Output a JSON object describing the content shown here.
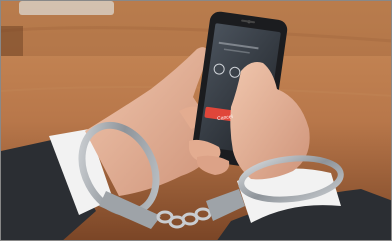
{
  "photo": {
    "subject": "",
    "phone_screen": {
      "call_button_label": "Cancel"
    },
    "colors": {
      "table": "#b8774a",
      "table_dark": "#7a4526",
      "sleeve": "#2b2e33",
      "cuff": "#f2f2f2",
      "skin": "#e6b49a",
      "handcuff_metal": "#9ea3a8",
      "phone_body": "#1b1c1f",
      "phone_screen": "#3a3f46",
      "call_button": "#e0463a"
    }
  }
}
